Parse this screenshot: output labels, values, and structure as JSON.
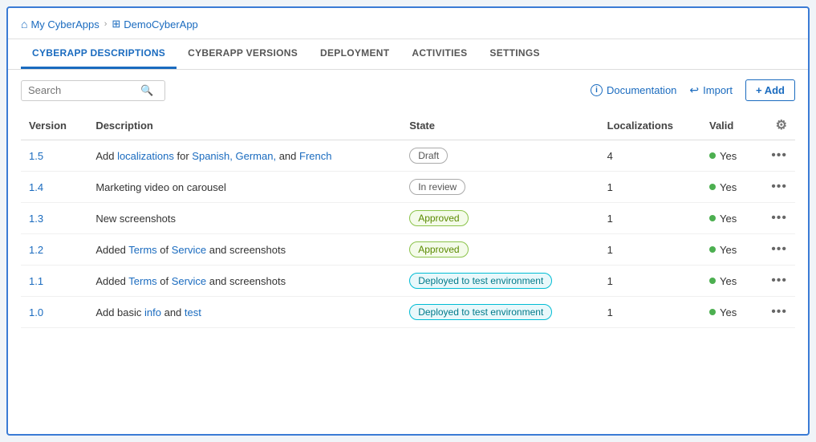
{
  "breadcrumb": {
    "home_label": "My CyberApps",
    "current_label": "DemoCyberApp",
    "separator": "›"
  },
  "tabs": [
    {
      "id": "descriptions",
      "label": "CYBERAPP DESCRIPTIONS",
      "active": true
    },
    {
      "id": "versions",
      "label": "CYBERAPP VERSIONS",
      "active": false
    },
    {
      "id": "deployment",
      "label": "DEPLOYMENT",
      "active": false
    },
    {
      "id": "activities",
      "label": "ACTIVITIES",
      "active": false
    },
    {
      "id": "settings",
      "label": "SETTINGS",
      "active": false
    }
  ],
  "toolbar": {
    "search_placeholder": "Search",
    "documentation_label": "Documentation",
    "import_label": "Import",
    "add_label": "+ Add"
  },
  "table": {
    "columns": [
      {
        "id": "version",
        "label": "Version"
      },
      {
        "id": "description",
        "label": "Description"
      },
      {
        "id": "state",
        "label": "State"
      },
      {
        "id": "localizations",
        "label": "Localizations"
      },
      {
        "id": "valid",
        "label": "Valid"
      },
      {
        "id": "settings",
        "label": ""
      }
    ],
    "rows": [
      {
        "version": "1.5",
        "description_html": "Add localizations for Spanish, German, and French",
        "highlights": [
          "localizations",
          "Spanish",
          "German",
          "French"
        ],
        "state": "Draft",
        "state_type": "draft",
        "localizations": "4",
        "valid": "Yes",
        "valid_green": true
      },
      {
        "version": "1.4",
        "description_html": "Marketing video on carousel",
        "highlights": [],
        "state": "In review",
        "state_type": "inreview",
        "localizations": "1",
        "valid": "Yes",
        "valid_green": true
      },
      {
        "version": "1.3",
        "description_html": "New screenshots",
        "highlights": [],
        "state": "Approved",
        "state_type": "approved",
        "localizations": "1",
        "valid": "Yes",
        "valid_green": true
      },
      {
        "version": "1.2",
        "description_html": "Added Terms of Service and screenshots",
        "highlights": [
          "Terms",
          "Service",
          "screenshots"
        ],
        "state": "Approved",
        "state_type": "approved",
        "localizations": "1",
        "valid": "Yes",
        "valid_green": true
      },
      {
        "version": "1.1",
        "description_html": "Added Terms of Service and screenshots",
        "highlights": [
          "Terms",
          "Service",
          "screenshots"
        ],
        "state": "Deployed to test environment",
        "state_type": "deployed",
        "localizations": "1",
        "valid": "Yes",
        "valid_green": true
      },
      {
        "version": "1.0",
        "description_html": "Add basic info and test",
        "highlights": [
          "info",
          "test"
        ],
        "state": "Deployed to test environment",
        "state_type": "deployed",
        "localizations": "1",
        "valid": "Yes",
        "valid_green": true
      }
    ]
  },
  "icons": {
    "home": "⌂",
    "grid": "⊞",
    "search": "🔍",
    "info": "ℹ",
    "import": "↩",
    "gear": "⚙",
    "more": "···"
  }
}
